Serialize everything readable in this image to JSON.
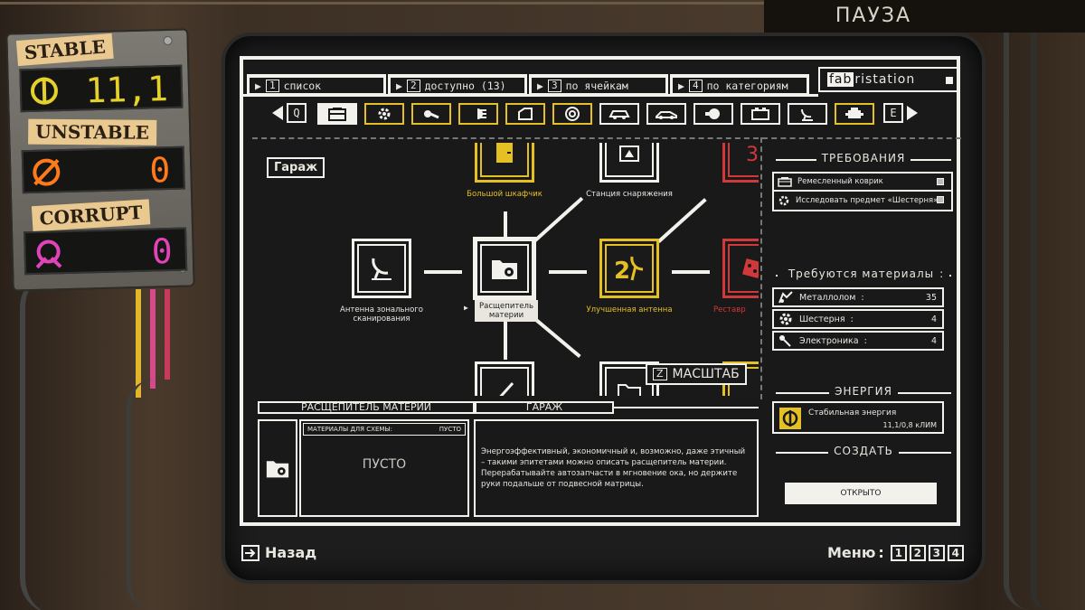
{
  "top": {
    "pause_label": "ПАУЗА"
  },
  "meter": {
    "stable": {
      "label": "STABLE",
      "value": "11,1",
      "color": "#e4d22a"
    },
    "unstable": {
      "label": "UNSTABLE",
      "value": "0",
      "color": "#ff7a1a"
    },
    "corrupt": {
      "label": "CORRUPT",
      "value": "0",
      "color": "#e044b8"
    }
  },
  "tabs": [
    {
      "key": "1",
      "label": "список"
    },
    {
      "key": "2",
      "label": "доступно (13)"
    },
    {
      "key": "3",
      "label": "по ячейкам"
    },
    {
      "key": "4",
      "label": "по категориям"
    }
  ],
  "brand": {
    "prefix": "fab",
    "suffix": "ristation"
  },
  "nav": {
    "prev_key": "Q",
    "next_key": "E"
  },
  "categories": [
    {
      "icon": "box-icon",
      "selected": true
    },
    {
      "icon": "gear-icon"
    },
    {
      "icon": "key-icon"
    },
    {
      "icon": "headlight-icon"
    },
    {
      "icon": "door-icon"
    },
    {
      "icon": "wheel-icon"
    },
    {
      "icon": "car-icon"
    },
    {
      "icon": "car-side-icon"
    },
    {
      "icon": "engine-icon"
    },
    {
      "icon": "battery-icon"
    },
    {
      "icon": "antenna-icon"
    },
    {
      "icon": "motor-icon"
    }
  ],
  "tree": {
    "section_label": "Гараж",
    "nodes": {
      "big_locker": "Большой шкафчик",
      "equip_station": "Станция снаряжения",
      "zonal_antenna": "Антенна зонального сканирования",
      "splitter": "Расщепитель материи",
      "improved_antenna": "Улучшенная антенна",
      "right_partial": "Реставр"
    },
    "zoom": {
      "key": "Z",
      "label": "МАСШТАБ"
    }
  },
  "requirements": {
    "title": "ТРЕБОВАНИЯ",
    "items": [
      "Ремесленный коврик",
      "Исследовать предмет «Шестерня»"
    ]
  },
  "materials": {
    "title": "Требуются материалы",
    "items": [
      {
        "name": "Металлолом",
        "qty": "35"
      },
      {
        "name": "Шестерня",
        "qty": "4"
      },
      {
        "name": "Электроника",
        "qty": "4"
      }
    ]
  },
  "energy": {
    "title": "ЭНЕРГИЯ",
    "name": "Стабильная энергия",
    "value": "11,1/0,8 кЛИМ"
  },
  "create": {
    "title": "СОЗДАТЬ",
    "button": "ОТКРЫТО"
  },
  "detail": {
    "name": "РАСЩЕПИТЕЛЬ МАТЕРИИ",
    "category": "ГАРАЖ",
    "schema_label": "МАТЕРИАЛЫ ДЛЯ СХЕМЫ:",
    "schema_status": "ПУСТО",
    "empty": "ПУСТО",
    "description": "Энергоэффективный, экономичный и, возможно, даже этичный – такими эпитетами можно описать расщепитель материи. Перерабатывайте автозапчасти в мгновение ока, но держите руки подальше от подвесной матрицы."
  },
  "footer": {
    "back": "Назад",
    "menu": "Меню",
    "menu_keys": [
      "1",
      "2",
      "3",
      "4"
    ]
  },
  "colors": {
    "white": "#f2f1ec",
    "gold": "#e4c024",
    "red": "#d0383a",
    "screen": "#191919"
  }
}
